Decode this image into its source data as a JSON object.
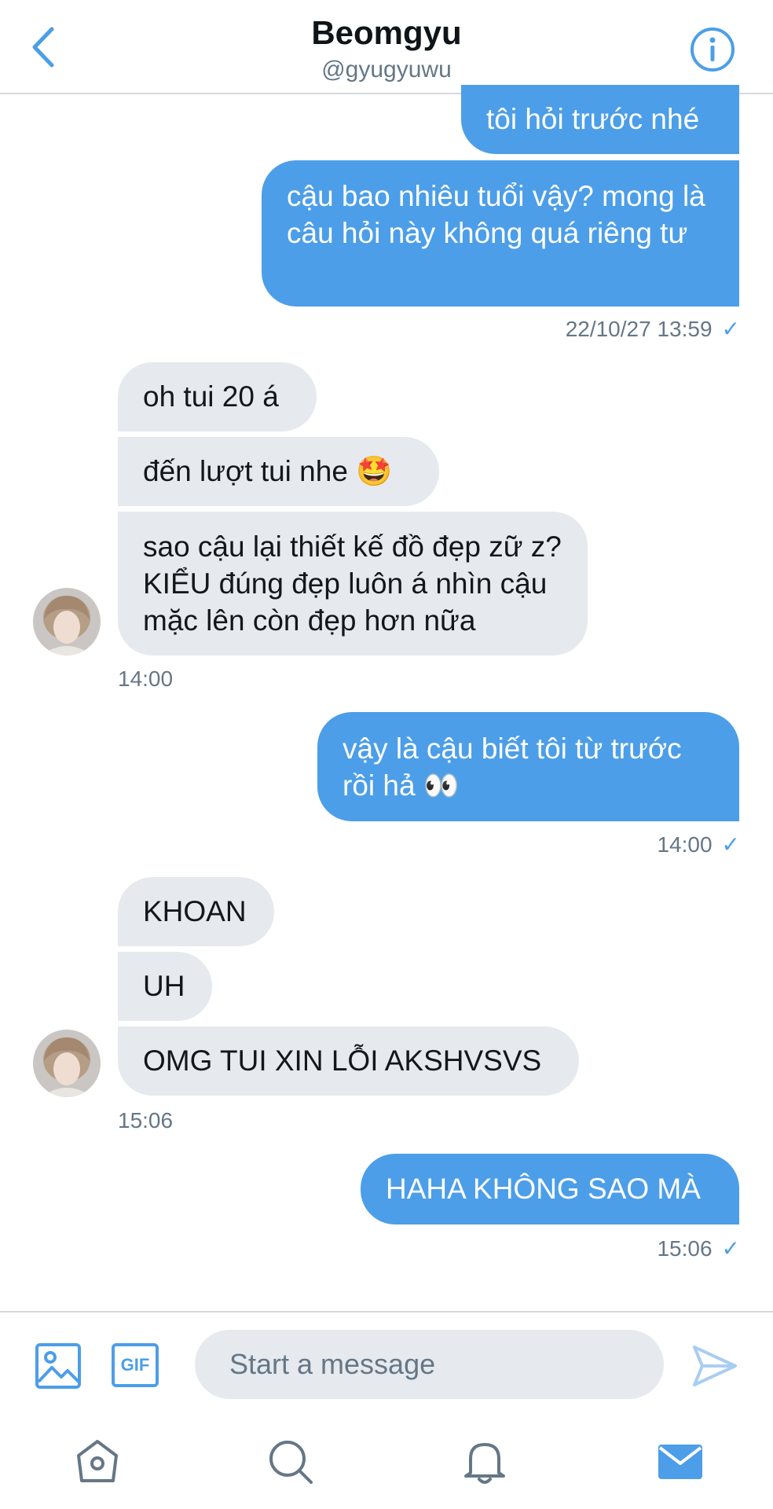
{
  "header": {
    "title": "Beomgyu",
    "handle": "@gyugyuwu"
  },
  "messages": [
    {
      "text": "tôi hỏi trước nhé",
      "side": "sent"
    },
    {
      "text": "cậu bao nhiêu tuổi vậy? mong là câu hỏi này không quá riêng tư",
      "side": "sent"
    },
    {
      "text": "oh tui 20 á",
      "side": "received"
    },
    {
      "text": "đến lượt tui nhe 🤩",
      "side": "received"
    },
    {
      "text": "sao cậu lại thiết kế đồ đẹp zữ z? KIỂU đúng đẹp luôn á nhìn cậu mặc lên còn đẹp hơn nữa",
      "side": "received"
    },
    {
      "text": "vậy là cậu biết tôi từ trước rồi hả 👀",
      "side": "sent"
    },
    {
      "text": "KHOAN",
      "side": "received"
    },
    {
      "text": "UH",
      "side": "received"
    },
    {
      "text": "OMG TUI XIN LỖI AKSHVSVS",
      "side": "received"
    },
    {
      "text": "HAHA KHÔNG SAO MÀ",
      "side": "sent"
    }
  ],
  "timestamps": [
    {
      "text": "22/10/27 13:59",
      "side": "sent"
    },
    {
      "text": "14:00",
      "side": "received"
    },
    {
      "text": "14:00",
      "side": "sent"
    },
    {
      "text": "15:06",
      "side": "received"
    },
    {
      "text": "15:06",
      "side": "sent"
    }
  ],
  "read_receipt": "✓",
  "composer": {
    "placeholder": "Start a message",
    "gif_label": "GIF"
  },
  "icons": {
    "back": "chevron-left-icon",
    "info": "info-icon",
    "image": "image-icon",
    "send": "send-icon",
    "home": "home-icon",
    "search": "search-icon",
    "notifications": "bell-icon",
    "messages": "mail-icon"
  },
  "colors": {
    "accent": "#4c9ee8",
    "received_bubble": "#e6e9ee",
    "secondary_text": "#657786",
    "divider": "#d6d9dc"
  }
}
